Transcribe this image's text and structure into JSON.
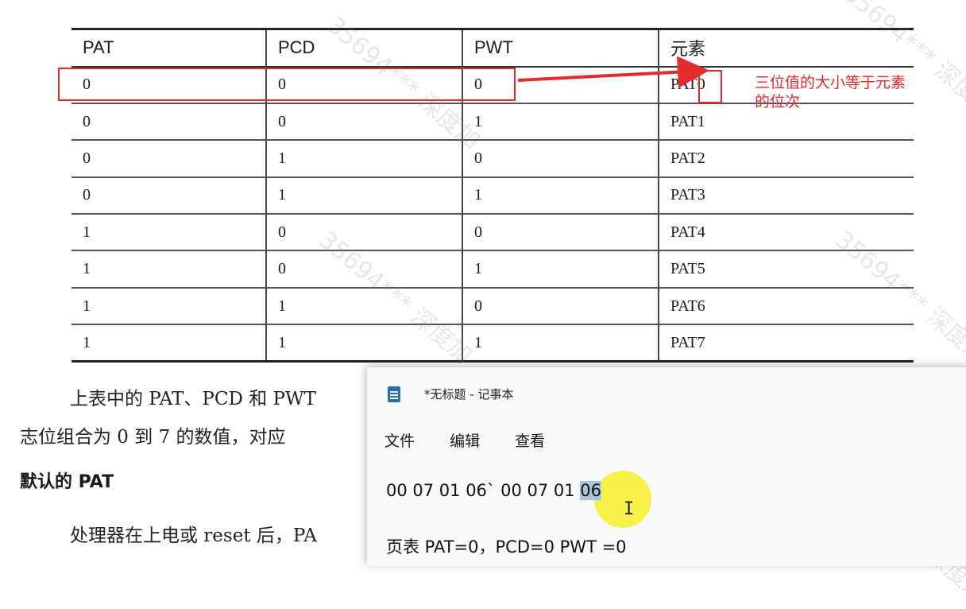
{
  "table": {
    "headers": [
      "PAT",
      "PCD",
      "PWT",
      "元素"
    ],
    "rows": [
      [
        "0",
        "0",
        "0",
        "PAT0"
      ],
      [
        "0",
        "0",
        "1",
        "PAT1"
      ],
      [
        "0",
        "1",
        "0",
        "PAT2"
      ],
      [
        "0",
        "1",
        "1",
        "PAT3"
      ],
      [
        "1",
        "0",
        "0",
        "PAT4"
      ],
      [
        "1",
        "0",
        "1",
        "PAT5"
      ],
      [
        "1",
        "1",
        "0",
        "PAT6"
      ],
      [
        "1",
        "1",
        "1",
        "PAT7"
      ]
    ]
  },
  "annotation": {
    "text": "三位值的大小等于元素的位次",
    "color": "#e52b2b"
  },
  "body_text": {
    "para1": "上表中的 PAT、PCD 和 PWT",
    "para2": "志位组合为 0 到 7 的数值，对应",
    "heading": "默认的 PAT",
    "para3": "处理器在上电或 reset 后，PA"
  },
  "watermark": {
    "text": "35694***  深度加"
  },
  "notepad": {
    "title": "*无标题 - 记事本",
    "menu": [
      "文件",
      "编辑",
      "查看"
    ],
    "line1_prefix": "00 07 01 06` 00 07 01 ",
    "line1_selected": "06",
    "line2": "页表 PAT=0，PCD=0 PWT =0",
    "cursor_icon": "text-cursor-icon"
  }
}
